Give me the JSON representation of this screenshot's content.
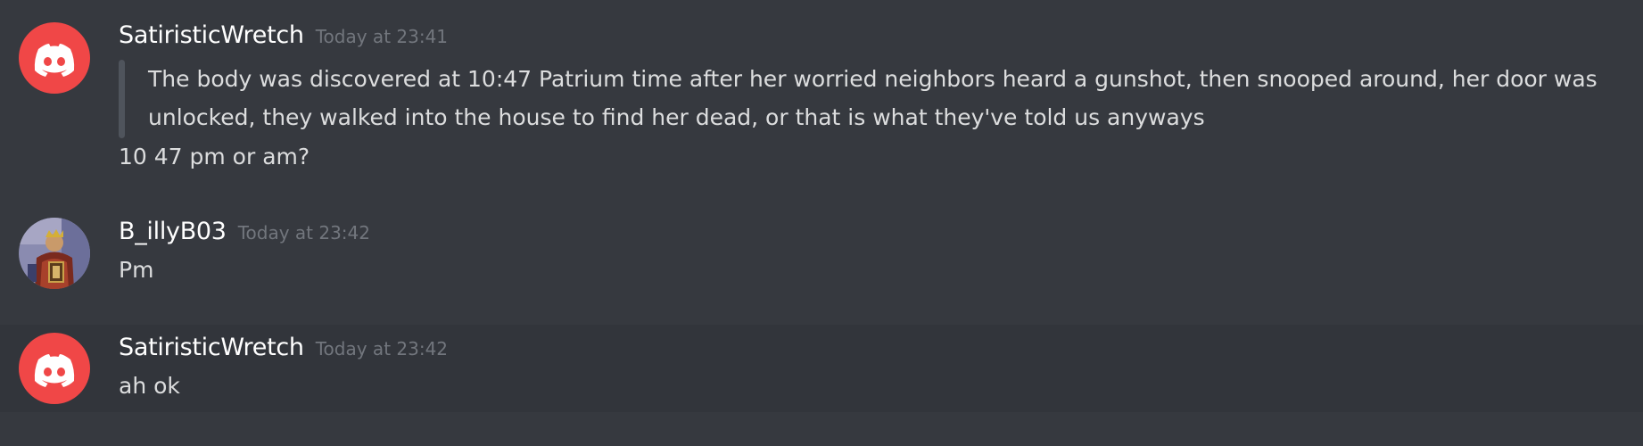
{
  "messages": [
    {
      "username": "SatiristicWretch",
      "timestamp": "Today at 23:41",
      "quote": "The body was discovered at 10:47 Patrium time after her worried neighbors heard a gunshot, then snooped around, her door was unlocked, they walked into the house to find her dead, or that is what they've told us anyways",
      "text": "10 47 pm or am?",
      "avatar_icon": "discord-logo-icon"
    },
    {
      "username": "B_illyB03",
      "timestamp": "Today at 23:42",
      "text": "Pm",
      "avatar_icon": "painted-figure-avatar"
    },
    {
      "username": "SatiristicWretch",
      "timestamp": "Today at 23:42",
      "text": "ah ok",
      "avatar_icon": "discord-logo-icon"
    }
  ],
  "colors": {
    "background": "#36393f",
    "hover_background": "#32353b",
    "discord_red": "#f04747",
    "username": "#ffffff",
    "timestamp": "#72767d",
    "message_text": "#dcddde",
    "quote_bar": "#4f545c"
  }
}
